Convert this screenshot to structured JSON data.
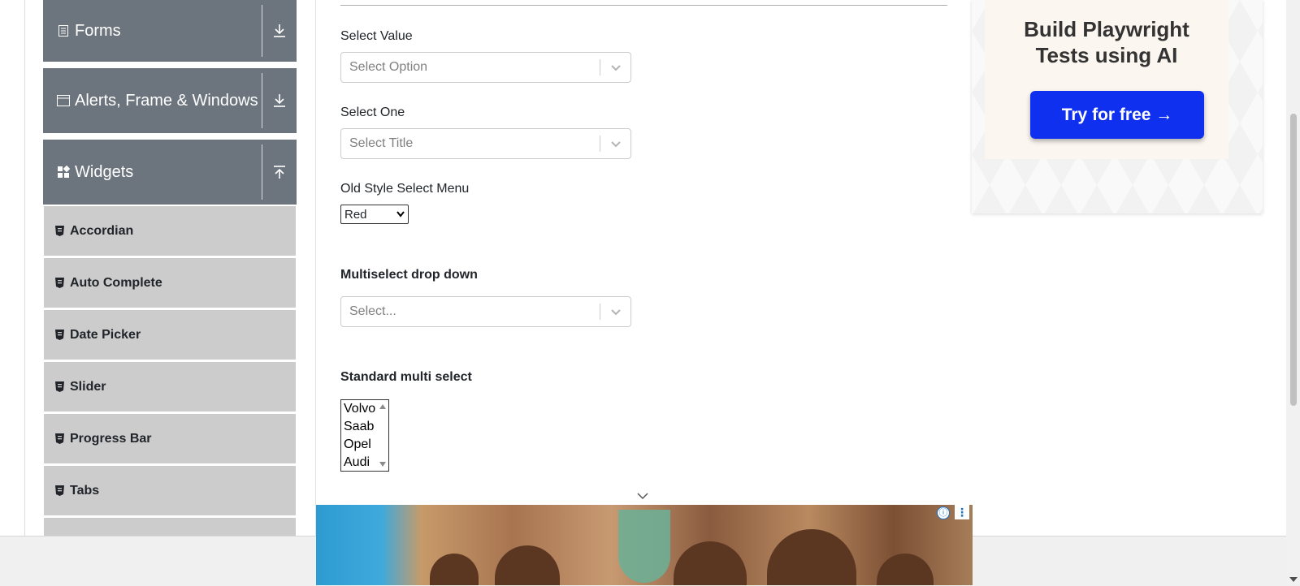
{
  "sidebar": {
    "groups": [
      {
        "label": "Forms",
        "icon": "form-icon",
        "arrow": "download-arrow-icon"
      },
      {
        "label": "Alerts, Frame & Windows",
        "icon": "window-icon",
        "arrow": "download-arrow-icon"
      },
      {
        "label": "Widgets",
        "icon": "widgets-icon",
        "arrow": "upload-arrow-icon"
      }
    ],
    "items": [
      {
        "label": "Accordian"
      },
      {
        "label": "Auto Complete"
      },
      {
        "label": "Date Picker"
      },
      {
        "label": "Slider"
      },
      {
        "label": "Progress Bar"
      },
      {
        "label": "Tabs"
      }
    ]
  },
  "form": {
    "select_value": {
      "label": "Select Value",
      "placeholder": "Select Option"
    },
    "select_one": {
      "label": "Select One",
      "placeholder": "Select Title"
    },
    "old_style": {
      "label": "Old Style Select Menu",
      "selected": "Red"
    },
    "multiselect": {
      "label": "Multiselect drop down",
      "placeholder": "Select..."
    },
    "standard_multi": {
      "label": "Standard multi select",
      "options": [
        "Volvo",
        "Saab",
        "Opel",
        "Audi"
      ]
    }
  },
  "ads": {
    "right": {
      "headline_line1": "Build Playwright",
      "headline_line2": "Tests using AI",
      "cta": "Try for free →"
    },
    "bottom": {
      "info_icon": "ⓘ",
      "more_icon": "⋮"
    }
  },
  "colors": {
    "sidebar_group": "#6c757d",
    "sidebar_item": "#cccccc",
    "cta": "#1030f0"
  }
}
